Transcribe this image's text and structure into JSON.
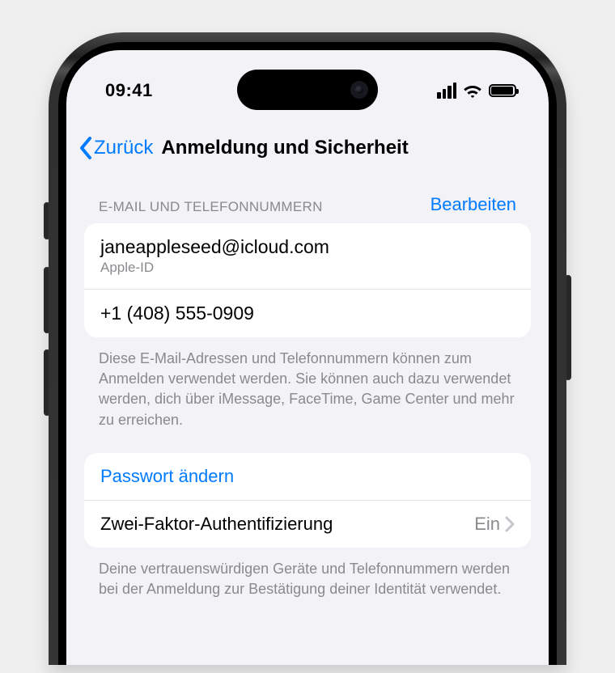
{
  "status": {
    "time": "09:41"
  },
  "nav": {
    "back": "Zurück",
    "title": "Anmeldung und Sicherheit"
  },
  "section_contacts": {
    "header": "E-MAIL UND TELEFONNUMMERN",
    "edit": "Bearbeiten",
    "rows": [
      {
        "primary": "janeappleseed@icloud.com",
        "sub": "Apple-ID"
      },
      {
        "primary": "+1 (408) 555-0909"
      }
    ],
    "footer": "Diese E-Mail-Adressen und Telefonnummern können zum Anmelden verwendet werden. Sie können auch dazu verwendet werden, dich über iMessage, FaceTime, Game Center und mehr zu erreichen."
  },
  "section_security": {
    "rows": {
      "change_password": "Passwort ändern",
      "twofa_label": "Zwei-Faktor-Authentifizierung",
      "twofa_value": "Ein"
    },
    "footer": "Deine vertrauenswürdigen Geräte und Telefon­nummern werden bei der Anmeldung zur Bestätigung deiner Identität verwendet."
  }
}
